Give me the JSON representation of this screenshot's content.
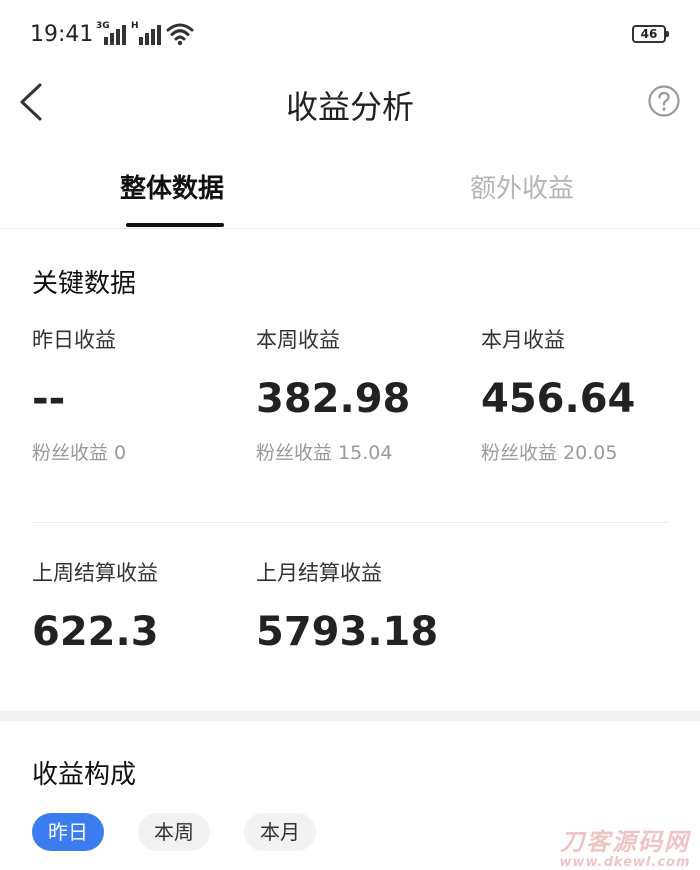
{
  "status_bar": {
    "time": "19:41",
    "signal1_tag": "3G",
    "signal2_tag": "H",
    "battery": "46"
  },
  "header": {
    "title": "收益分析",
    "back_icon": "chevron-left-icon",
    "help_icon": "question-circle-icon"
  },
  "tabs": [
    {
      "label": "整体数据",
      "active": true
    },
    {
      "label": "额外收益",
      "active": false
    }
  ],
  "key_data": {
    "title": "关键数据",
    "yesterday": {
      "label": "昨日收益",
      "value": "--",
      "fans": "粉丝收益 0"
    },
    "this_week": {
      "label": "本周收益",
      "value": "382.98",
      "fans": "粉丝收益 15.04"
    },
    "this_month": {
      "label": "本月收益",
      "value": "456.64",
      "fans": "粉丝收益 20.05"
    },
    "last_week_settled": {
      "label": "上周结算收益",
      "value": "622.3"
    },
    "last_month_settled": {
      "label": "上月结算收益",
      "value": "5793.18"
    }
  },
  "composition": {
    "title": "收益构成",
    "chips": [
      {
        "label": "昨日",
        "active": true
      },
      {
        "label": "本周",
        "active": false
      },
      {
        "label": "本月",
        "active": false
      }
    ]
  },
  "watermark": {
    "main": "刀客源码网",
    "sub": "www.dkewl.com"
  },
  "colors": {
    "accent": "#3b7cf0",
    "muted_text": "#9a9a9a",
    "inactive_tab": "#b5b5b5"
  }
}
